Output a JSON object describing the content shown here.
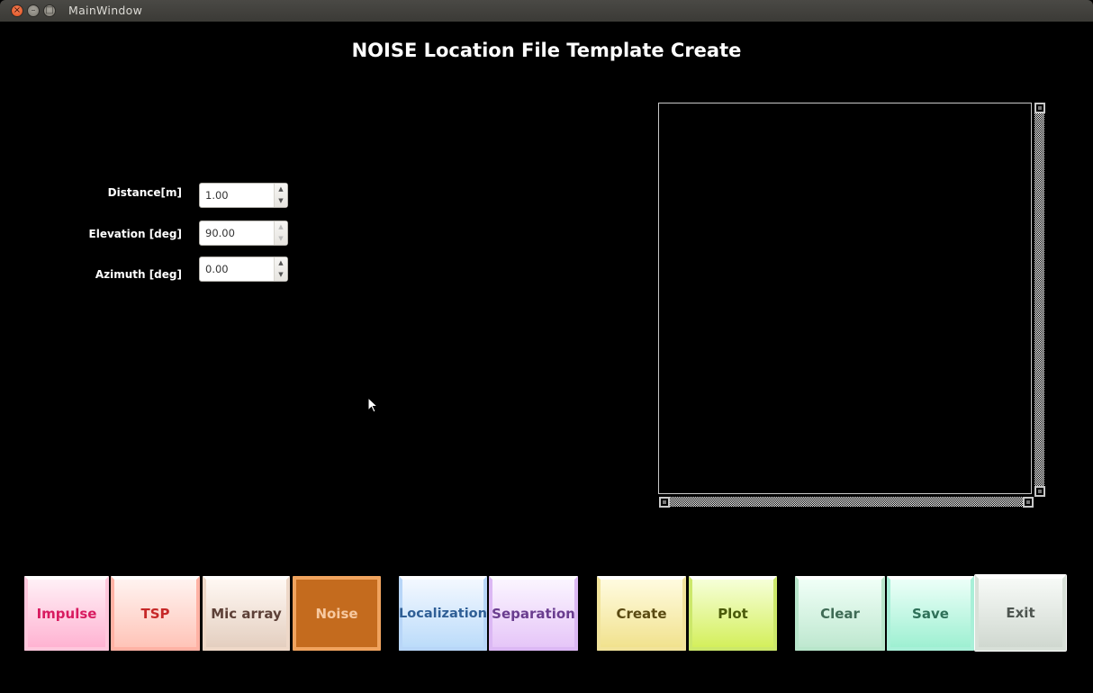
{
  "window": {
    "title": "MainWindow",
    "controls": {
      "close": "×",
      "minimize": "–",
      "maximize": "□"
    }
  },
  "header": {
    "title": "NOISE Location File Template Create"
  },
  "form": {
    "fields": [
      {
        "label": "Distance[m]",
        "value": "1.00",
        "up_icon": "▲",
        "down_icon": "▼",
        "disabled_arrow": "none"
      },
      {
        "label": "Elevation [deg]",
        "value": "90.00",
        "up_icon": "▲",
        "down_icon": "▼",
        "disabled_arrow": "both"
      },
      {
        "label": "Azimuth [deg]",
        "value": "0.00",
        "up_icon": "▲",
        "down_icon": "▼",
        "disabled_arrow": "none"
      }
    ]
  },
  "plot": {
    "scroll_up_icon": "scroll-up",
    "scroll_down_icon": "scroll-down",
    "scroll_left_icon": "scroll-left",
    "scroll_right_icon": "scroll-right"
  },
  "buttons": [
    {
      "id": "impulse",
      "label": "Impulse",
      "text_color": "#d81b60",
      "bg_top": "#fff0f6",
      "bg_bottom": "#ffb3d2",
      "border": "#ffc7dc",
      "selected": false
    },
    {
      "id": "tsp",
      "label": "TSP",
      "text_color": "#c62828",
      "bg_top": "#fff3f0",
      "bg_bottom": "#ffc4b8",
      "border": "#ffb2a4",
      "selected": false
    },
    {
      "id": "mic-array",
      "label": "Mic array",
      "text_color": "#5d4037",
      "bg_top": "#fff8f3",
      "bg_bottom": "#e4cfc0",
      "border": "#eed8c8",
      "selected": false
    },
    {
      "id": "noise",
      "label": "Noise",
      "text_color": "#f7c9a0",
      "bg_top": "#c46b1e",
      "bg_bottom": "#c46b1e",
      "border": "#f0a35e",
      "selected": true
    },
    {
      "id": "localization",
      "label": "Localization",
      "text_color": "#2f5f96",
      "bg_top": "#f3f8ff",
      "bg_bottom": "#bcdcfa",
      "border": "#b8d6f8",
      "selected": false
    },
    {
      "id": "separation",
      "label": "Separation",
      "text_color": "#6a3d8f",
      "bg_top": "#fbf5ff",
      "bg_bottom": "#e6c6f8",
      "border": "#dcb8f4",
      "selected": false
    },
    {
      "id": "create",
      "label": "Create",
      "text_color": "#5a4a12",
      "bg_top": "#fffbe0",
      "bg_bottom": "#f1e28e",
      "border": "#f1e39a",
      "selected": false
    },
    {
      "id": "plot",
      "label": "Plot",
      "text_color": "#4a5a0a",
      "bg_top": "#f6ffd8",
      "bg_bottom": "#d4ef5c",
      "border": "#cce86a",
      "selected": false
    },
    {
      "id": "clear",
      "label": "Clear",
      "text_color": "#3f6b55",
      "bg_top": "#f0fff7",
      "bg_bottom": "#bfe8d0",
      "border": "#b8e6cb",
      "selected": false
    },
    {
      "id": "save",
      "label": "Save",
      "text_color": "#2e7058",
      "bg_top": "#ecfff8",
      "bg_bottom": "#9ef0d2",
      "border": "#a8f0d8",
      "selected": false
    },
    {
      "id": "exit",
      "label": "Exit",
      "text_color": "#4e5550",
      "bg_top": "#f7faf7",
      "bg_bottom": "#d0d8d0",
      "border": "#d8e0d8",
      "selected": false,
      "focused": true
    }
  ]
}
